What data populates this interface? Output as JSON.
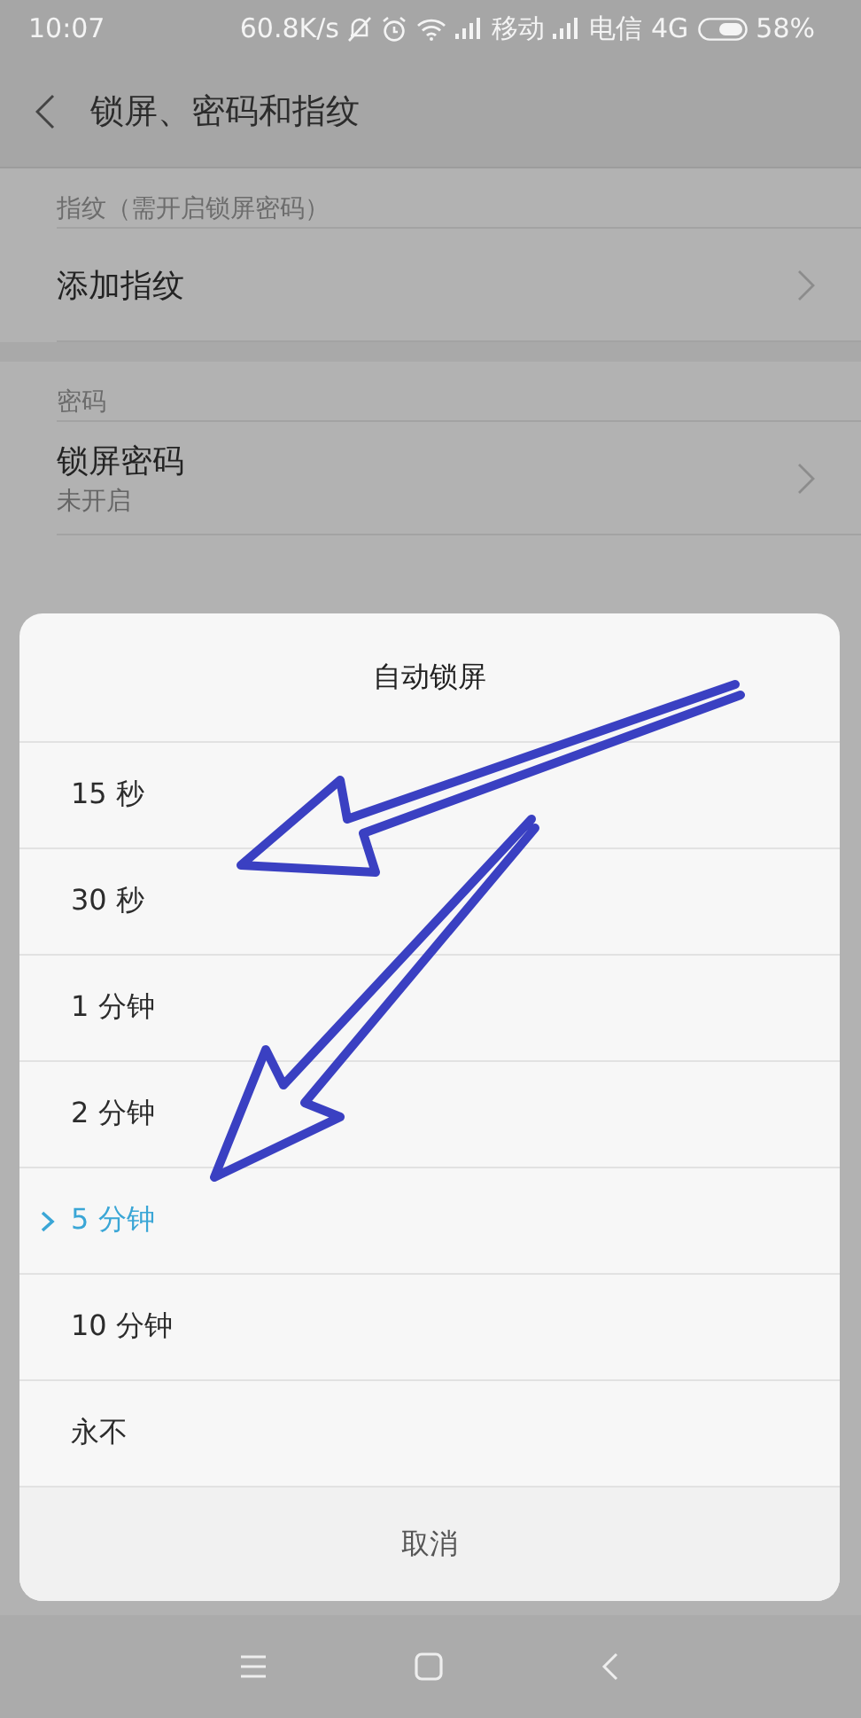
{
  "status_bar": {
    "time": "10:07",
    "speed": "60.8K/s",
    "carrier_1": "移动",
    "carrier_2": "电信",
    "network": "4G",
    "battery": "58%"
  },
  "header": {
    "title": "锁屏、密码和指纹"
  },
  "sections": [
    {
      "title": "指纹（需开启锁屏密码）",
      "rows": [
        {
          "kind": "link",
          "label": "添加指纹"
        }
      ]
    },
    {
      "title": "密码",
      "rows": [
        {
          "kind": "link",
          "label": "锁屏密码",
          "subtitle": "未开启"
        }
      ]
    }
  ],
  "dialog": {
    "title": "自动锁屏",
    "options": [
      {
        "label": "15 秒",
        "selected": false
      },
      {
        "label": "30 秒",
        "selected": false
      },
      {
        "label": "1 分钟",
        "selected": false
      },
      {
        "label": "2 分钟",
        "selected": false
      },
      {
        "label": "5 分钟",
        "selected": true
      },
      {
        "label": "10 分钟",
        "selected": false
      },
      {
        "label": "永不",
        "selected": false
      }
    ],
    "cancel": "取消"
  }
}
